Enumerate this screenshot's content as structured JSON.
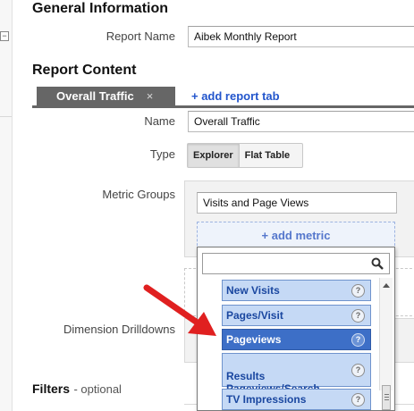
{
  "general": {
    "title": "General Information",
    "report_name_label": "Report Name",
    "report_name_value": "Aibek Monthly Report"
  },
  "content": {
    "title": "Report Content",
    "tab_label": "Overall Traffic",
    "tab_close": "×",
    "add_tab": "+ add report tab",
    "name_label": "Name",
    "name_value": "Overall Traffic",
    "type_label": "Type",
    "type_options": [
      "Explorer",
      "Flat Table"
    ],
    "type_selected": "Explorer",
    "metric_groups_label": "Metric Groups",
    "metric_group_name": "Visits and Page Views",
    "add_metric": "+ add metric",
    "dimension_label": "Dimension Drilldowns"
  },
  "dropdown": {
    "search_value": "",
    "items": [
      {
        "label": "New Visits"
      },
      {
        "label": "Pages/Visit"
      },
      {
        "label": "Pageviews",
        "selected": true
      },
      {
        "label": "Results\nPageviews/Search"
      },
      {
        "label": "TV Impressions"
      }
    ],
    "help": "?"
  },
  "filters": {
    "title": "Filters",
    "optional": "- optional"
  },
  "icons": {
    "collapse": "collapse-icon",
    "search": "search-icon",
    "help": "help-icon",
    "arrow": "red-arrow-annotation"
  },
  "colors": {
    "accent_link": "#2255cc",
    "item_bg": "#c5d9f5",
    "item_selected": "#3d6fc7",
    "arrow": "#e02020"
  }
}
